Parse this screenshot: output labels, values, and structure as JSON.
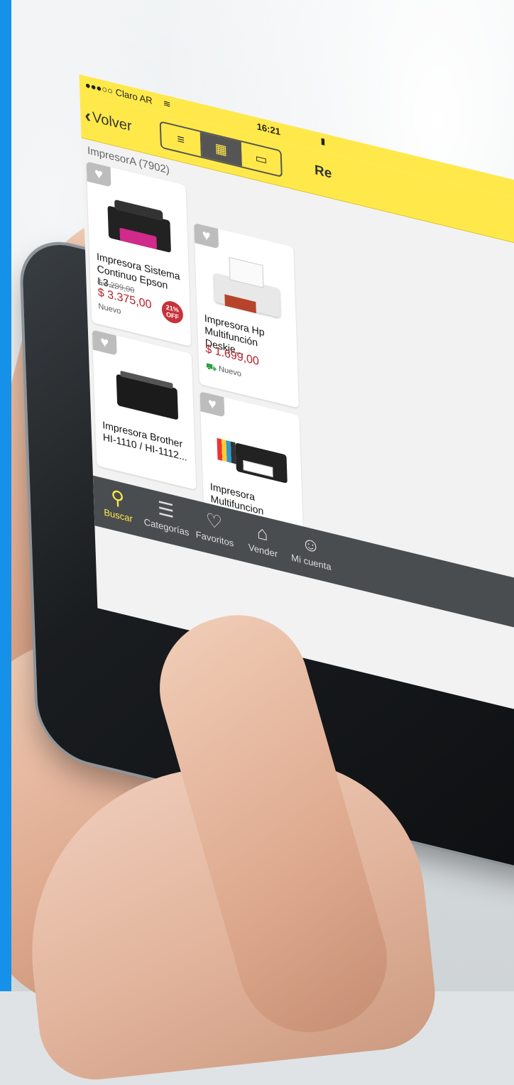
{
  "status_bar": {
    "carrier": "●●●○○ Claro AR",
    "wifi_icon": "wifi-icon",
    "time": "16:21",
    "battery_icon": "battery-icon"
  },
  "nav": {
    "back_label": "Volver",
    "back_icon": "chevron-left-icon",
    "view_modes": [
      {
        "icon": "list-view-icon",
        "glyph": "≡",
        "active": false
      },
      {
        "icon": "grid-view-icon",
        "glyph": "▦",
        "active": true
      },
      {
        "icon": "gallery-view-icon",
        "glyph": "▭",
        "active": false
      }
    ],
    "refine_label": "Re"
  },
  "results_label": "ImpresorA (7902)",
  "products": [
    {
      "title": "Impresora Sistema Continuo Epson L3...",
      "old_price": "$ 4.299,00",
      "price": "$ 3.375,00",
      "badge": "21% OFF",
      "condition": "Nuevo",
      "free_shipping": false
    },
    {
      "title": "Impresora Hp Multifunción Deskje...",
      "old_price": "",
      "price": "$ 1.699,00",
      "badge": "",
      "condition": "Nuevo",
      "free_shipping": true
    },
    {
      "title": "Impresora Brother HI-1110 / HI-1112...",
      "old_price": "",
      "price": "",
      "badge": "",
      "condition": "",
      "free_shipping": false
    },
    {
      "title": "Impresora Multifuncion Epson...",
      "old_price": "",
      "price": "",
      "badge": "",
      "condition": "",
      "free_shipping": false
    }
  ],
  "tabs": [
    {
      "label": "Buscar",
      "icon": "search-icon",
      "glyph": "⚲",
      "active": true
    },
    {
      "label": "Categorías",
      "icon": "categories-icon",
      "glyph": "☰",
      "active": false
    },
    {
      "label": "Favoritos",
      "icon": "heart-icon",
      "glyph": "♡",
      "active": false
    },
    {
      "label": "Vender",
      "icon": "tag-icon",
      "glyph": "⌂",
      "active": false
    },
    {
      "label": "Mi cuenta",
      "icon": "user-icon",
      "glyph": "☺",
      "active": false
    }
  ],
  "colors": {
    "accent_yellow": "#ffe94a",
    "price_red": "#b5212a",
    "tab_bar": "#4a4d50",
    "blue_strip": "#1591ea"
  }
}
